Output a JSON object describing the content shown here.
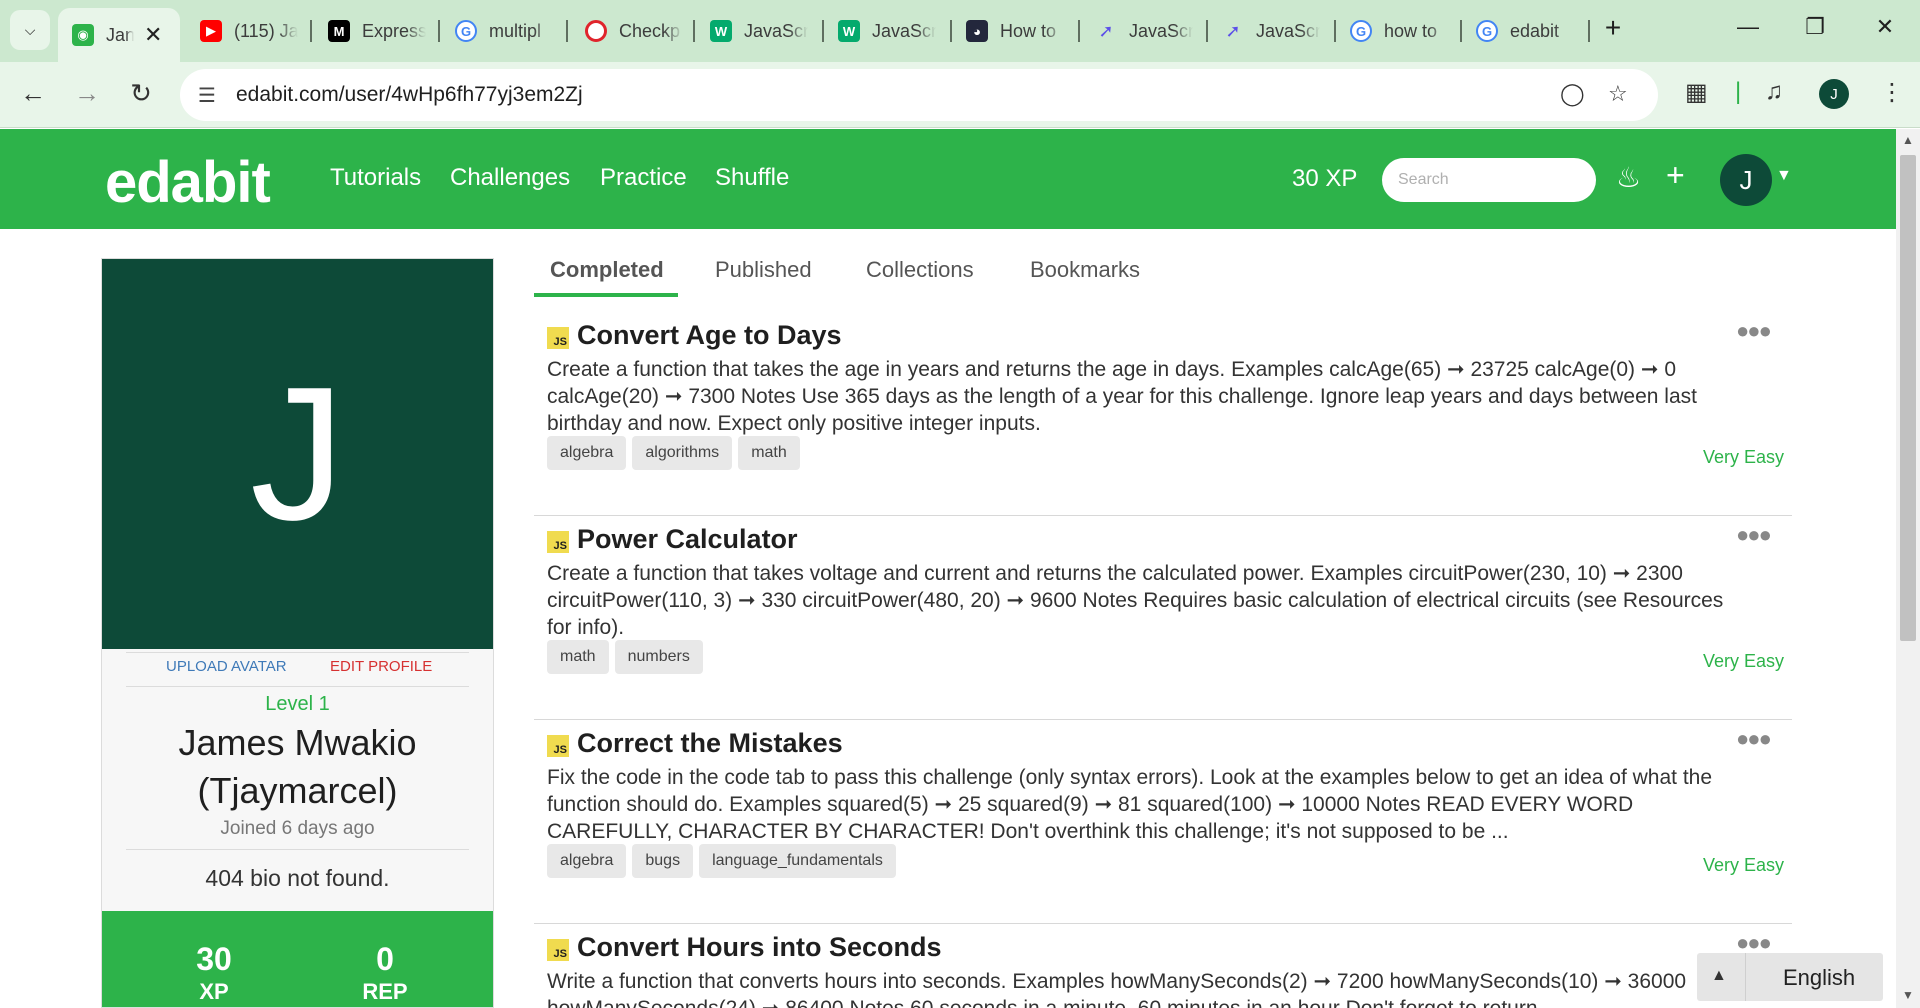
{
  "browser": {
    "tabs": [
      {
        "title": "Jan",
        "favicon": "edabit-icon",
        "color": "#2db34a"
      },
      {
        "title": "(115) Ja",
        "favicon": "youtube-icon",
        "color": "#ff0000"
      },
      {
        "title": "Express",
        "favicon": "m-icon",
        "color": "#000000"
      },
      {
        "title": "multipl",
        "favicon": "google-icon",
        "color": "#4285f4"
      },
      {
        "title": "Checkp",
        "favicon": "opera-icon",
        "color": "#e0242c"
      },
      {
        "title": "JavaScr",
        "favicon": "w3-icon",
        "color": "#04aa6d"
      },
      {
        "title": "JavaScr",
        "favicon": "w3-icon",
        "color": "#04aa6d"
      },
      {
        "title": "How to",
        "favicon": "cat-icon",
        "color": "#23273c"
      },
      {
        "title": "JavaScr",
        "favicon": "bolt-icon",
        "color": "#5b4fe9"
      },
      {
        "title": "JavaScr",
        "favicon": "bolt-icon",
        "color": "#5b4fe9"
      },
      {
        "title": "how to",
        "favicon": "google-icon",
        "color": "#4285f4"
      },
      {
        "title": "edabit",
        "favicon": "google-icon",
        "color": "#4285f4"
      }
    ],
    "url": "edabit.com/user/4wHp6fh77yj3em2Zj",
    "profile_initial": "J"
  },
  "header": {
    "logo": "edabit",
    "nav": [
      "Tutorials",
      "Challenges",
      "Practice",
      "Shuffle"
    ],
    "xp": "30 XP",
    "search_placeholder": "Search",
    "avatar_initial": "J",
    "brand_color": "#2db34a"
  },
  "profile": {
    "avatar_letter": "J",
    "upload_avatar": "UPLOAD AVATAR",
    "edit_profile": "EDIT PROFILE",
    "level": "Level 1",
    "name": "James Mwakio (Tjaymarcel)",
    "joined": "Joined 6 days ago",
    "bio": "404 bio not found.",
    "xp_value": "30",
    "xp_label": "XP",
    "rep_value": "0",
    "rep_label": "REP"
  },
  "content_tabs": [
    "Completed",
    "Published",
    "Collections",
    "Bookmarks"
  ],
  "challenges": [
    {
      "lang": "JS",
      "title": "Convert Age to Days",
      "description": "Create a function that takes the age in years and returns the age in days. Examples calcAge(65) ➞ 23725 calcAge(0) ➞ 0 calcAge(20) ➞ 7300 Notes Use 365 days as the length of a year for this challenge. Ignore leap years and days between last birthday and now. Expect only positive integer inputs.",
      "tags": [
        "algebra",
        "algorithms",
        "math"
      ],
      "difficulty": "Very Easy"
    },
    {
      "lang": "JS",
      "title": "Power Calculator",
      "description": "Create a function that takes voltage and current and returns the calculated power. Examples circuitPower(230, 10) ➞ 2300 circuitPower(110, 3) ➞ 330 circuitPower(480, 20) ➞ 9600 Notes Requires basic calculation of electrical circuits (see Resources for info).",
      "tags": [
        "math",
        "numbers"
      ],
      "difficulty": "Very Easy"
    },
    {
      "lang": "JS",
      "title": "Correct the Mistakes",
      "description": "Fix the code in the code tab to pass this challenge (only syntax errors). Look at the examples below to get an idea of what the function should do. Examples squared(5) ➞ 25 squared(9) ➞ 81 squared(100) ➞ 10000 Notes READ EVERY WORD CAREFULLY, CHARACTER BY CHARACTER! Don't overthink this challenge; it's not supposed to be ...",
      "tags": [
        "algebra",
        "bugs",
        "language_fundamentals"
      ],
      "difficulty": "Very Easy"
    },
    {
      "lang": "JS",
      "title": "Convert Hours into Seconds",
      "description": "Write a function that converts hours into seconds. Examples howManySeconds(2) ➞ 7200 howManySeconds(10) ➞ 36000 howManySeconds(24) ➞ 86400 Notes 60 seconds in a minute, 60 minutes in an hour Don't forget to return",
      "tags": [],
      "difficulty": ""
    }
  ],
  "language_widget": {
    "label": "English"
  }
}
